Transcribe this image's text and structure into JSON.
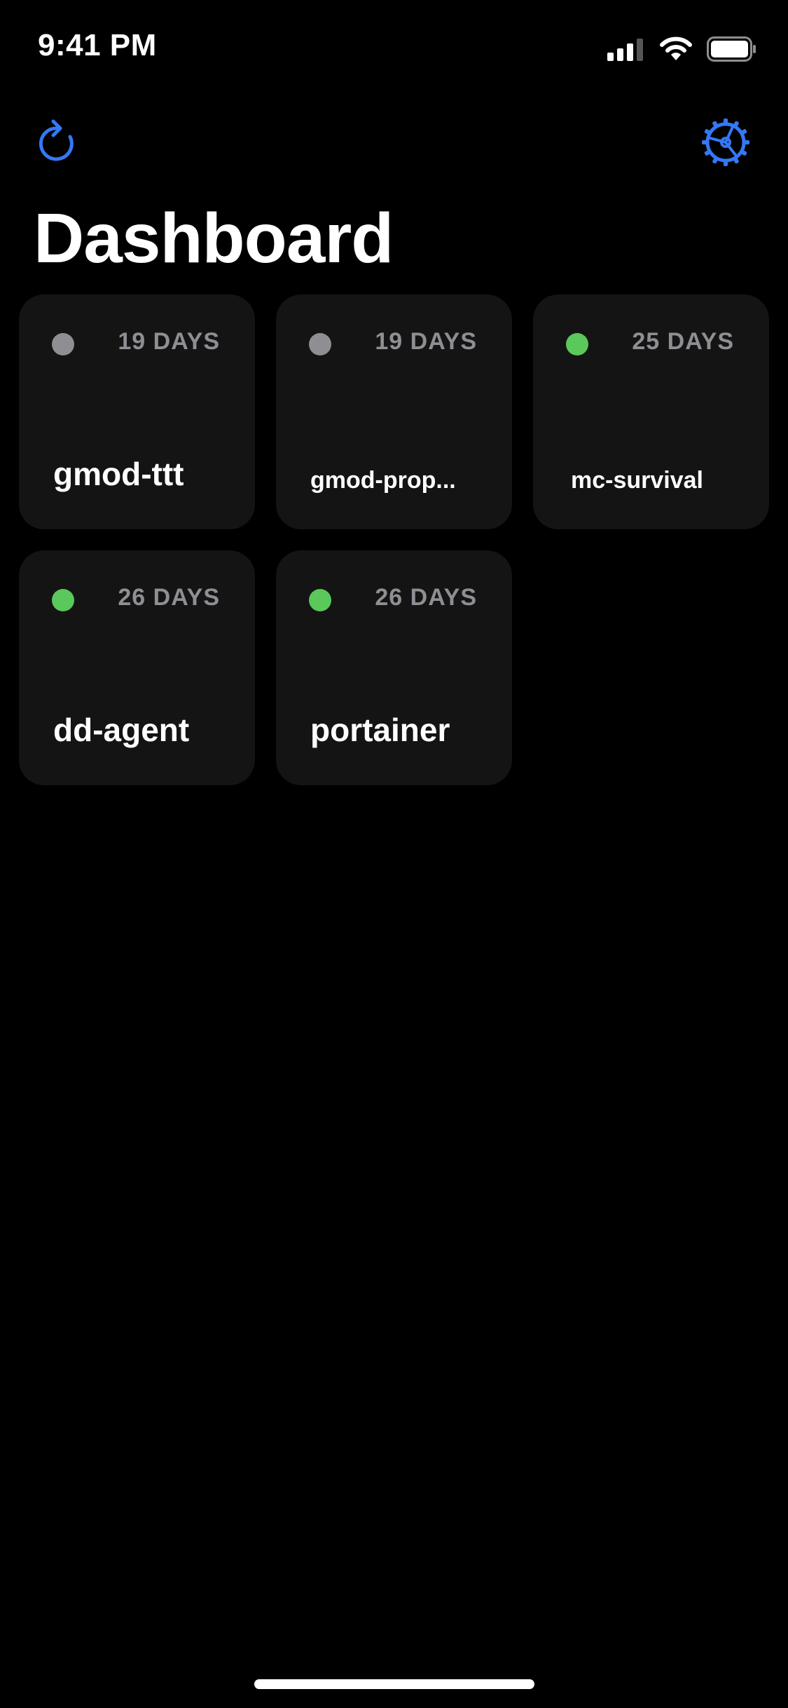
{
  "status_bar": {
    "time": "9:41 PM"
  },
  "toolbar": {
    "refresh_icon": "refresh-icon",
    "settings_icon": "gear-icon"
  },
  "page": {
    "title": "Dashboard"
  },
  "colors": {
    "accent": "#3478f6",
    "running": "#5ac85a",
    "stopped": "#8e8e93",
    "card": "#141414"
  },
  "containers": [
    {
      "name": "gmod-ttt",
      "uptime": "19 DAYS",
      "status": "stopped"
    },
    {
      "name": "gmod-prop...",
      "uptime": "19 DAYS",
      "status": "stopped"
    },
    {
      "name": "mc-survival",
      "uptime": "25 DAYS",
      "status": "running"
    },
    {
      "name": "dd-agent",
      "uptime": "26 DAYS",
      "status": "running"
    },
    {
      "name": "portainer",
      "uptime": "26 DAYS",
      "status": "running"
    }
  ]
}
